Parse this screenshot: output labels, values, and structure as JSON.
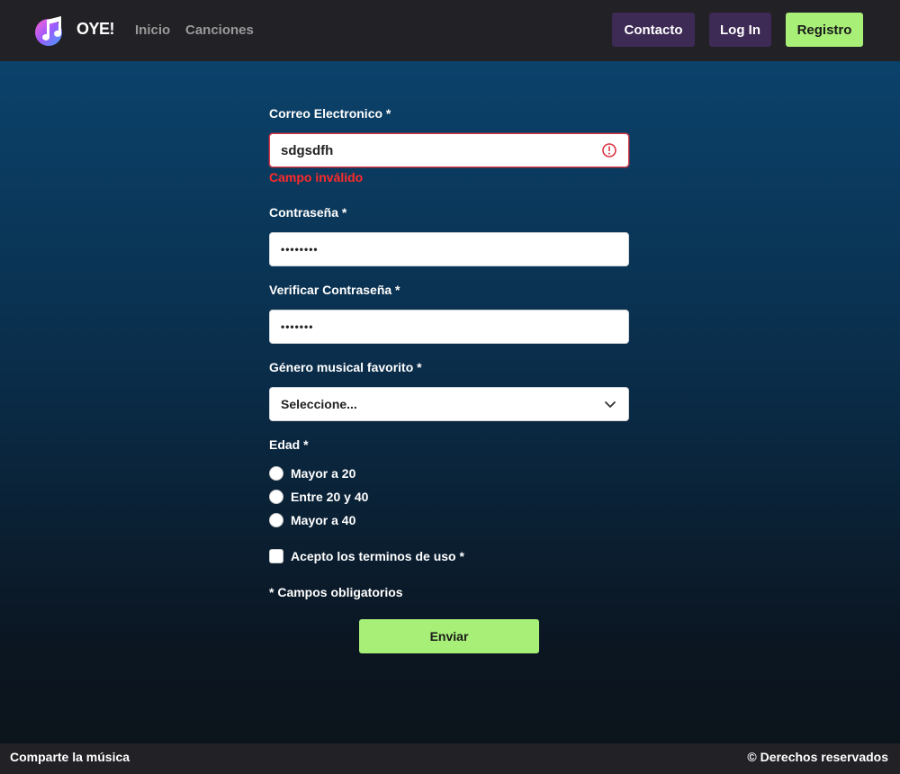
{
  "navbar": {
    "brand": "OYE!",
    "links": [
      "Inicio",
      "Canciones"
    ],
    "buttons": {
      "contacto": "Contacto",
      "login": "Log In",
      "registro": "Registro"
    },
    "colors": {
      "background": "#222126",
      "dark_button": "#3d2a55",
      "accent": "#a8ef78"
    }
  },
  "form": {
    "email": {
      "label": "Correo Electronico *",
      "value": "sdgsdfh",
      "error": "Campo inválido",
      "state": "invalid"
    },
    "password": {
      "label": "Contraseña *",
      "value": "••••••••"
    },
    "verify_password": {
      "label": "Verificar Contraseña *",
      "value": "•••••••"
    },
    "genre": {
      "label": "Género musical favorito *",
      "selected": "Seleccione..."
    },
    "age": {
      "label": "Edad *",
      "options": [
        "Mayor a 20",
        "Entre 20 y 40",
        "Mayor a 40"
      ]
    },
    "terms": {
      "label": "Acepto los terminos de uso *",
      "checked": false
    },
    "required_note": "* Campos obligatorios",
    "submit_label": "Enviar",
    "colors": {
      "error": "#ff2a2a",
      "submit": "#a8ef78"
    }
  },
  "footer": {
    "left": "Comparte la música",
    "right": "© Derechos reservados"
  },
  "icons": [
    "music-note-icon",
    "error-circle-icon",
    "chevron-down-icon"
  ]
}
